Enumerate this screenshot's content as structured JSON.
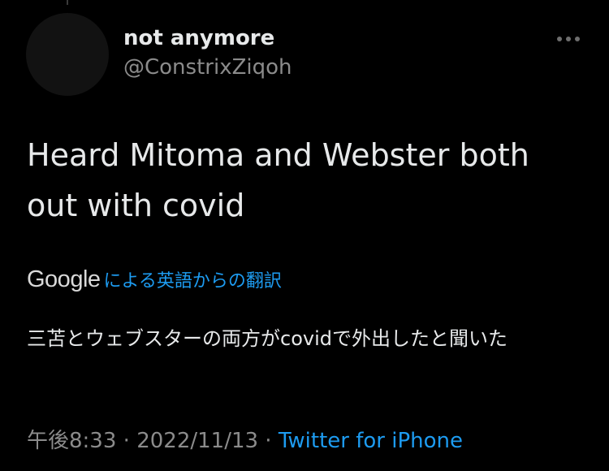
{
  "tweet": {
    "author": {
      "display_name": "not anymore",
      "handle": "@ConstrixZiqoh"
    },
    "more_icon": "more-horizontal-icon",
    "text": "Heard Mitoma and Webster both out with covid",
    "translation": {
      "provider": "Google",
      "label": "による英語からの翻訳",
      "text": "三苫とウェブスターの両方がcovidで外出したと聞いた"
    },
    "meta": {
      "time": "午後8:33",
      "separator1": " · ",
      "date": "2022/11/13",
      "separator2": " · ",
      "source": "Twitter for iPhone"
    }
  },
  "colors": {
    "background": "#000000",
    "primary_text": "#e7e9ea",
    "secondary_text": "#8b8b8b",
    "link": "#1d9bf0"
  }
}
